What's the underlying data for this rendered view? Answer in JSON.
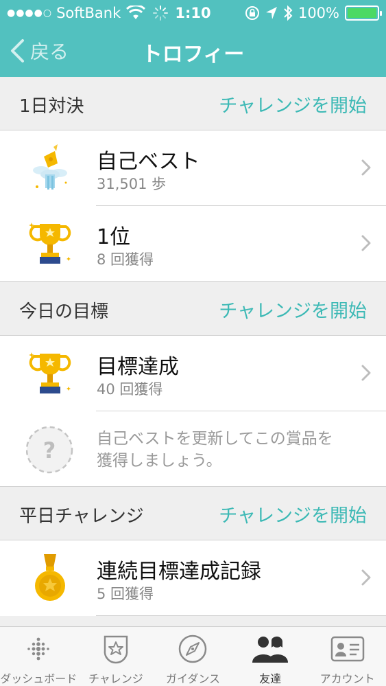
{
  "status_bar": {
    "carrier": "SoftBank",
    "time": "1:10",
    "battery": "100%",
    "icons": [
      "signal-dots-icon",
      "wifi-icon",
      "activity-spinner-icon",
      "orientation-lock-icon",
      "location-arrow-icon",
      "bluetooth-icon",
      "battery-icon"
    ]
  },
  "nav": {
    "back_label": "戻る",
    "title": "トロフィー"
  },
  "sections": [
    {
      "title": "1日対決",
      "action": "チャレンジを開始",
      "rows": [
        {
          "icon": "trophy-personal-best-icon",
          "label": "自己ベスト",
          "sub": "31,501 歩"
        },
        {
          "icon": "gold-trophy-icon",
          "label": "1位",
          "sub": "8 回獲得"
        }
      ]
    },
    {
      "title": "今日の目標",
      "action": "チャレンジを開始",
      "rows": [
        {
          "icon": "gold-trophy-icon",
          "label": "目標達成",
          "sub": "40 回獲得"
        },
        {
          "icon": "locked-question-icon",
          "hint": "自己ベストを更新してこの賞品を獲得しましょう。"
        }
      ]
    },
    {
      "title": "平日チャレンジ",
      "action": "チャレンジを開始",
      "rows": [
        {
          "icon": "gold-medal-icon",
          "label": "連続目標達成記録",
          "sub": "5 回獲得"
        }
      ]
    }
  ],
  "tabs": [
    {
      "label": "ダッシュボード",
      "icon": "dashboard-dots-icon",
      "active": false
    },
    {
      "label": "チャレンジ",
      "icon": "challenge-badge-icon",
      "active": false
    },
    {
      "label": "ガイダンス",
      "icon": "compass-icon",
      "active": false
    },
    {
      "label": "友達",
      "icon": "friends-icon",
      "active": true
    },
    {
      "label": "アカウント",
      "icon": "account-card-icon",
      "active": false
    }
  ],
  "colors": {
    "accent": "#52c1bf",
    "action_text": "#3cb9b5",
    "trophy_gold": "#f5b800",
    "battery_green": "#4cd964"
  }
}
